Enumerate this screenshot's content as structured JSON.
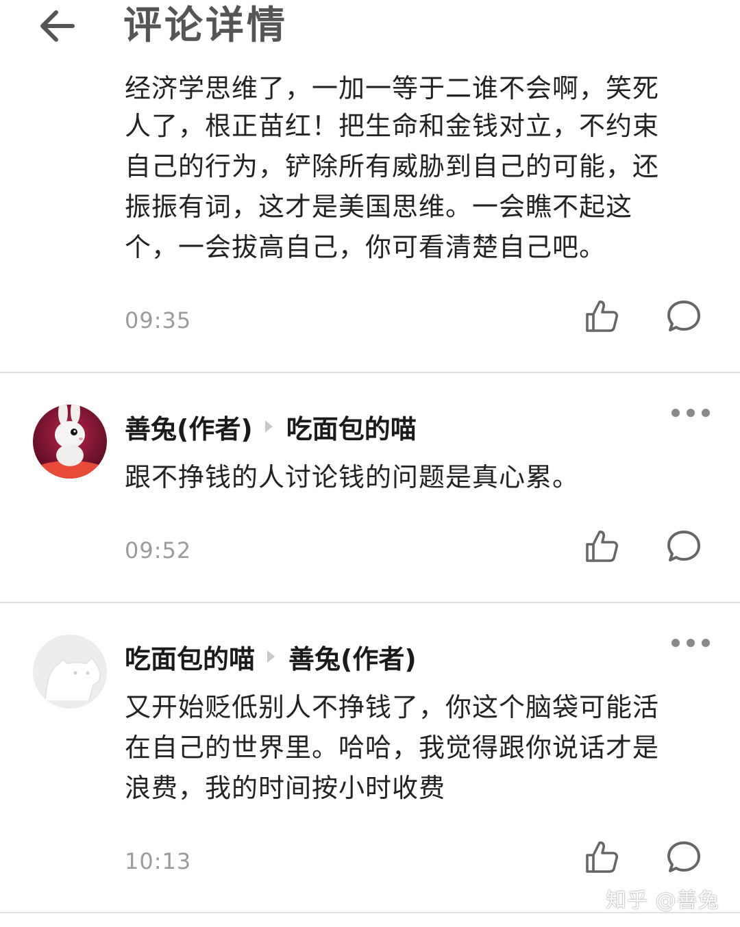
{
  "header": {
    "back_icon": "arrow-left-icon",
    "title": "评论详情"
  },
  "comments": [
    {
      "clipped_line": "经济学思维了，一加一等于二谁不会啊，笑死",
      "lines": [
        "人了，根正苗红！把生命和金钱对立，不约束",
        "自己的行为，铲除所有威胁到自己的可能，还",
        "振振有词，这才是美国思维。一会瞧不起这",
        "个，一会拔高自己，你可看清楚自己吧。"
      ],
      "time": "09:35"
    },
    {
      "author": "善兔(作者)",
      "reply_to": "吃面包的喵",
      "lines": [
        "跟不挣钱的人讨论钱的问题是真心累。"
      ],
      "time": "09:52"
    },
    {
      "author": "吃面包的喵",
      "reply_to": "善兔(作者)",
      "lines": [
        "又开始贬低别人不挣钱了，你这个脑袋可能活",
        "在自己的世界里。哈哈，我觉得跟你说话才是",
        "浪费，我的时间按小时收费"
      ],
      "time": "10:13"
    }
  ],
  "icons": {
    "like": "thumbs-up-icon",
    "reply": "comment-bubble-icon",
    "more": "more-dots-icon"
  },
  "watermark": "知乎 @善兔"
}
